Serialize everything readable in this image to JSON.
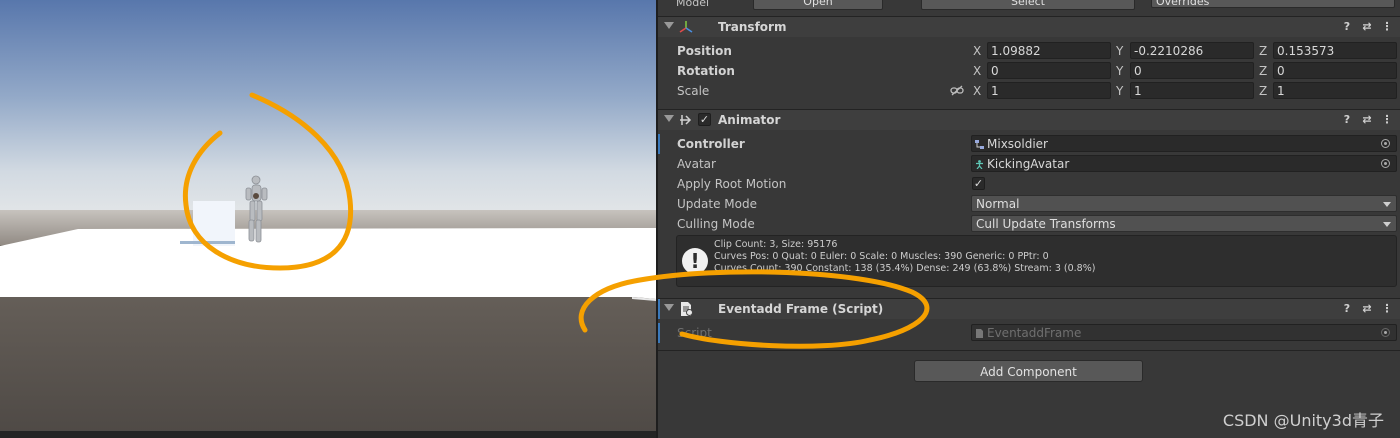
{
  "colors": {
    "annotation": "#F5A000",
    "inspector_bg": "#383838",
    "field_bg": "#2A2A2A",
    "accent_blue": "#3A79BB"
  },
  "topbar": {
    "model_label": "Model",
    "open_label": "Open",
    "select_label": "Select",
    "overrides_label": "Overrides"
  },
  "transform": {
    "title": "Transform",
    "position": {
      "label": "Position",
      "x": "1.09882",
      "y": "-0.2210286",
      "z": "0.153573"
    },
    "rotation": {
      "label": "Rotation",
      "x": "0",
      "y": "0",
      "z": "0"
    },
    "scale": {
      "label": "Scale",
      "x": "1",
      "y": "1",
      "z": "1"
    },
    "axis_x": "X",
    "axis_y": "Y",
    "axis_z": "Z"
  },
  "animator": {
    "title": "Animator",
    "controller": {
      "label": "Controller",
      "value": "Mixsoldier"
    },
    "avatar": {
      "label": "Avatar",
      "value": "KickingAvatar"
    },
    "apply_root_motion": {
      "label": "Apply Root Motion",
      "checked": true
    },
    "update_mode": {
      "label": "Update Mode",
      "value": "Normal"
    },
    "culling_mode": {
      "label": "Culling Mode",
      "value": "Cull Update Transforms"
    },
    "info": {
      "line1": "Clip Count: 3, Size: 95176",
      "line2": "Curves Pos: 0 Quat: 0 Euler: 0 Scale: 0 Muscles: 390 Generic: 0 PPtr: 0",
      "line3": "Curves Count: 390 Constant: 138 (35.4%) Dense: 249 (63.8%) Stream: 3 (0.8%)"
    }
  },
  "script_component": {
    "title": "Eventadd Frame (Script)",
    "script": {
      "label": "Script",
      "value": "EventaddFrame"
    }
  },
  "add_component_label": "Add Component",
  "watermark": "CSDN @Unity3d青子",
  "icons": {
    "help": "?",
    "presets": "⇄",
    "menu": "⋮",
    "check": "✓",
    "warning": "!"
  }
}
